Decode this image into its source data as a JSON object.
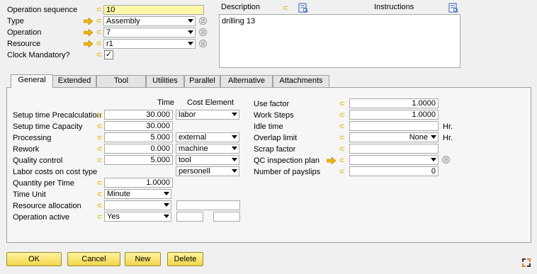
{
  "header": {
    "operation_sequence": {
      "label": "Operation sequence",
      "value": "10"
    },
    "type": {
      "label": "Type",
      "value": "Assembly"
    },
    "operation": {
      "label": "Operation",
      "value": "7"
    },
    "resource": {
      "label": "Resource",
      "value": "r1"
    },
    "clock_mandatory": {
      "label": "Clock Mandatory?",
      "checked": true,
      "mark": "✓"
    },
    "description": {
      "label": "Description",
      "value": "drilling 13"
    },
    "instructions": {
      "label": "Instructions"
    }
  },
  "tabs": [
    "General",
    "Extended",
    "Tool",
    "Utilities",
    "Parallel",
    "Alternative",
    "Attachments"
  ],
  "active_tab": "General",
  "general": {
    "col_time": "Time",
    "col_cost_element": "Cost Element",
    "rows": [
      {
        "label": "Setup time Precalculation",
        "time": "30.000",
        "cost": "labor"
      },
      {
        "label": "Setup time Capacity",
        "time": "30.000",
        "cost": ""
      },
      {
        "label": "Processing",
        "time": "5.000",
        "cost": "external"
      },
      {
        "label": "Rework",
        "time": "0.000",
        "cost": "machine"
      },
      {
        "label": "Quality control",
        "time": "5.000",
        "cost": "tool"
      },
      {
        "label": "Labor costs on cost type",
        "time": "",
        "cost": "personell"
      }
    ],
    "quantity_per_time": {
      "label": "Quantity per Time",
      "value": "1.0000"
    },
    "time_unit": {
      "label": "Time Unit",
      "value": "Minute"
    },
    "resource_allocation": {
      "label": "Resource allocation",
      "value": ""
    },
    "operation_active": {
      "label": "Operation active",
      "value": "Yes"
    },
    "right": {
      "use_factor": {
        "label": "Use factor",
        "value": "1.0000"
      },
      "work_steps": {
        "label": "Work Steps",
        "value": "1.0000"
      },
      "idle_time": {
        "label": "Idle time",
        "value": "",
        "unit": "Hr."
      },
      "overlap_limit": {
        "label": "Overlap limit",
        "value": "None",
        "unit": "Hr."
      },
      "scrap_factor": {
        "label": "Scrap factor",
        "value": ""
      },
      "qc_inspection_plan": {
        "label": "QC inspection plan",
        "value": ""
      },
      "number_of_payslips": {
        "label": "Number of payslips",
        "value": "0"
      }
    }
  },
  "buttons": {
    "ok": "OK",
    "cancel": "Cancel",
    "new": "New",
    "delete": "Delete"
  },
  "colors": {
    "accent_yellow": "#fff7a8",
    "button_gold": "#f2d64a",
    "link_icon": "#e6b800",
    "arrow": "#f0b400"
  }
}
